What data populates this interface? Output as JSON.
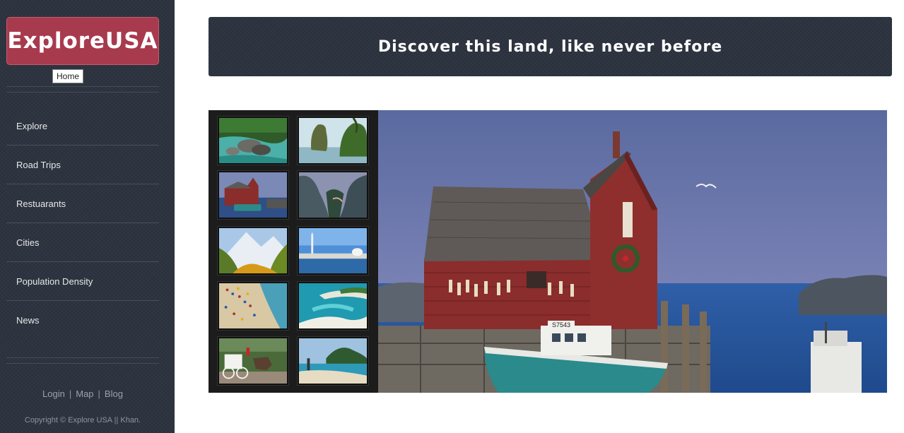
{
  "sidebar": {
    "logo": "ExploreUSA",
    "tooltip": "Home",
    "nav": [
      "Explore",
      "Road Trips",
      "Restuarants",
      "Cities",
      "Population Density",
      "News"
    ],
    "footer_links": [
      "Login",
      "Map",
      "Blog"
    ],
    "footer_sep": "|",
    "copyright": "Copyright © Explore USA || Khan."
  },
  "header": {
    "tagline": "Discover this land, like never before"
  },
  "gallery": {
    "thumbnails": [
      "river-rocks-thumbnail",
      "sea-stack-thumbnail",
      "red-fishing-shack-thumbnail",
      "canyon-valley-thumbnail",
      "mountain-autumn-thumbnail",
      "capital-city-thumbnail",
      "beach-crowd-thumbnail",
      "turquoise-sandbar-thumbnail",
      "horse-carriage-thumbnail",
      "tropical-coast-thumbnail"
    ],
    "main_image": "red-fishing-shack-harbor",
    "boat_number": "S7543"
  },
  "colors": {
    "sidebar_bg": "#2d3440",
    "logo_bg": "#a83a4e",
    "banner_bg": "#2d3440",
    "gallery_bg": "#1c1c1c"
  }
}
